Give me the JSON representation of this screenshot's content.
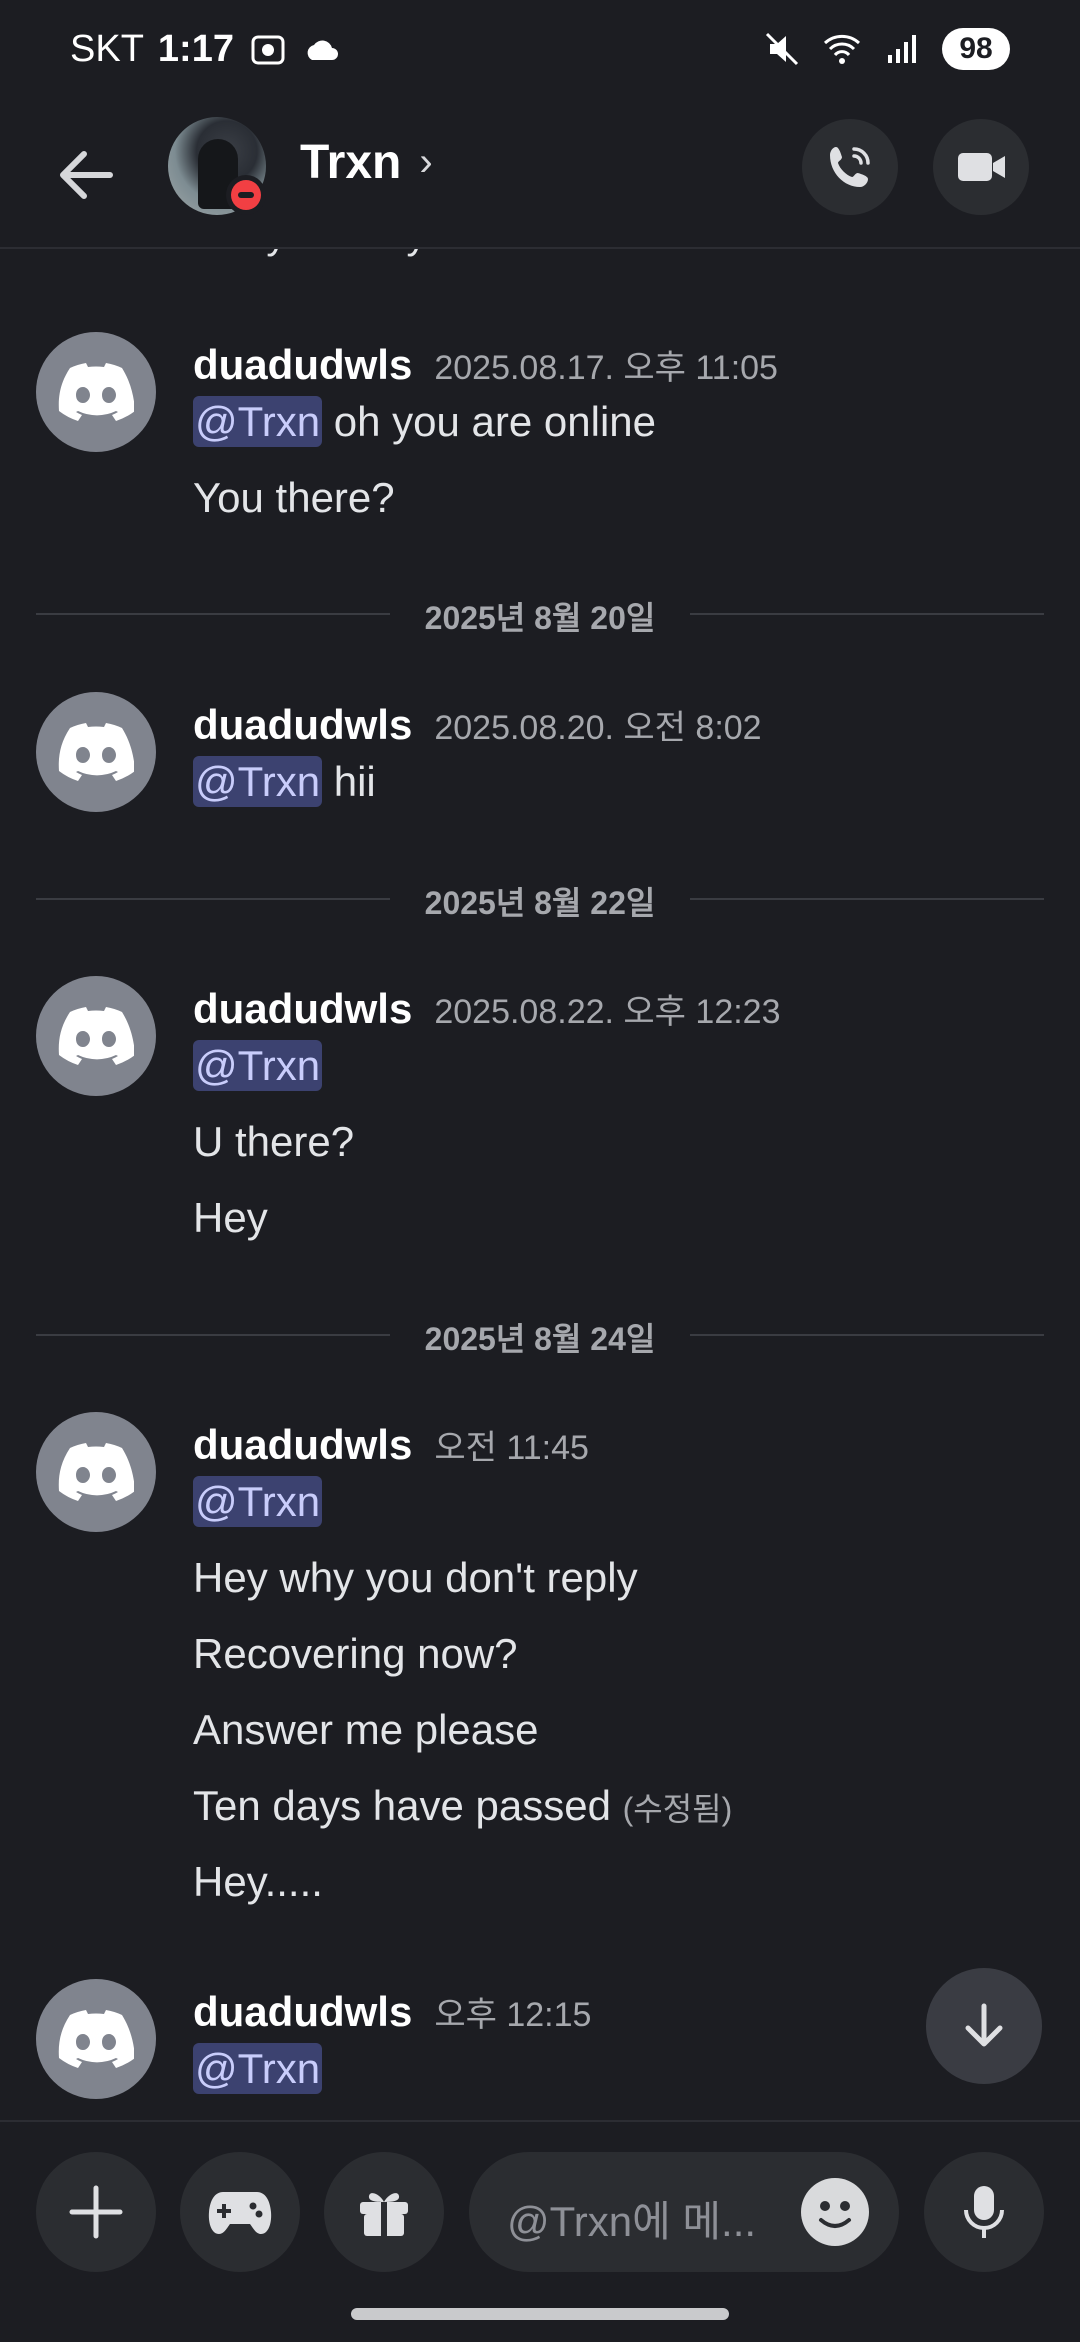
{
  "status_bar": {
    "carrier": "SKT",
    "time": "1:17",
    "battery": "98"
  },
  "header": {
    "title": "Trxn",
    "chevron": "›"
  },
  "messages": {
    "clipped_text": "Are you okay?",
    "groups": [
      {
        "username": "duadudwls",
        "timestamp": "2025.08.17. 오후 11:05",
        "lines": [
          {
            "mention": "@Trxn",
            "text": " oh you are online"
          },
          {
            "text": "You there?"
          }
        ]
      },
      {
        "divider": "2025년 8월 20일"
      },
      {
        "username": "duadudwls",
        "timestamp": "2025.08.20. 오전 8:02",
        "lines": [
          {
            "mention": "@Trxn",
            "text": " hii"
          }
        ]
      },
      {
        "divider": "2025년 8월 22일"
      },
      {
        "username": "duadudwls",
        "timestamp": "2025.08.22. 오후 12:23",
        "lines": [
          {
            "mention": "@Trxn"
          },
          {
            "text": "U there?"
          },
          {
            "text": "Hey"
          }
        ]
      },
      {
        "divider": "2025년 8월 24일"
      },
      {
        "username": "duadudwls",
        "timestamp": "오전 11:45",
        "lines": [
          {
            "mention": "@Trxn"
          },
          {
            "text": "Hey why you don't reply"
          },
          {
            "text": "Recovering now?"
          },
          {
            "text": "Answer me please"
          },
          {
            "text": "Ten days have passed",
            "edited": "(수정됨)"
          },
          {
            "text": "Hey....."
          }
        ]
      },
      {
        "username": "duadudwls",
        "timestamp": "오후 12:15",
        "lines": [
          {
            "mention": "@Trxn"
          }
        ]
      }
    ]
  },
  "composer": {
    "placeholder": "@Trxn에 메..."
  },
  "icons": {
    "back": "arrow-left-icon",
    "call": "phone-call-icon",
    "video": "video-camera-icon",
    "add": "plus-icon",
    "games": "gamepad-icon",
    "gift": "gift-icon",
    "emoji": "emoji-icon",
    "mic": "microphone-icon",
    "scroll": "arrow-down-icon",
    "avatar": "discord-logo-icon"
  },
  "colors": {
    "background": "#1c1d22",
    "mention_bg": "#3c4270",
    "mention_text": "#c9cdfb",
    "dnd_status": "#f23f43"
  }
}
